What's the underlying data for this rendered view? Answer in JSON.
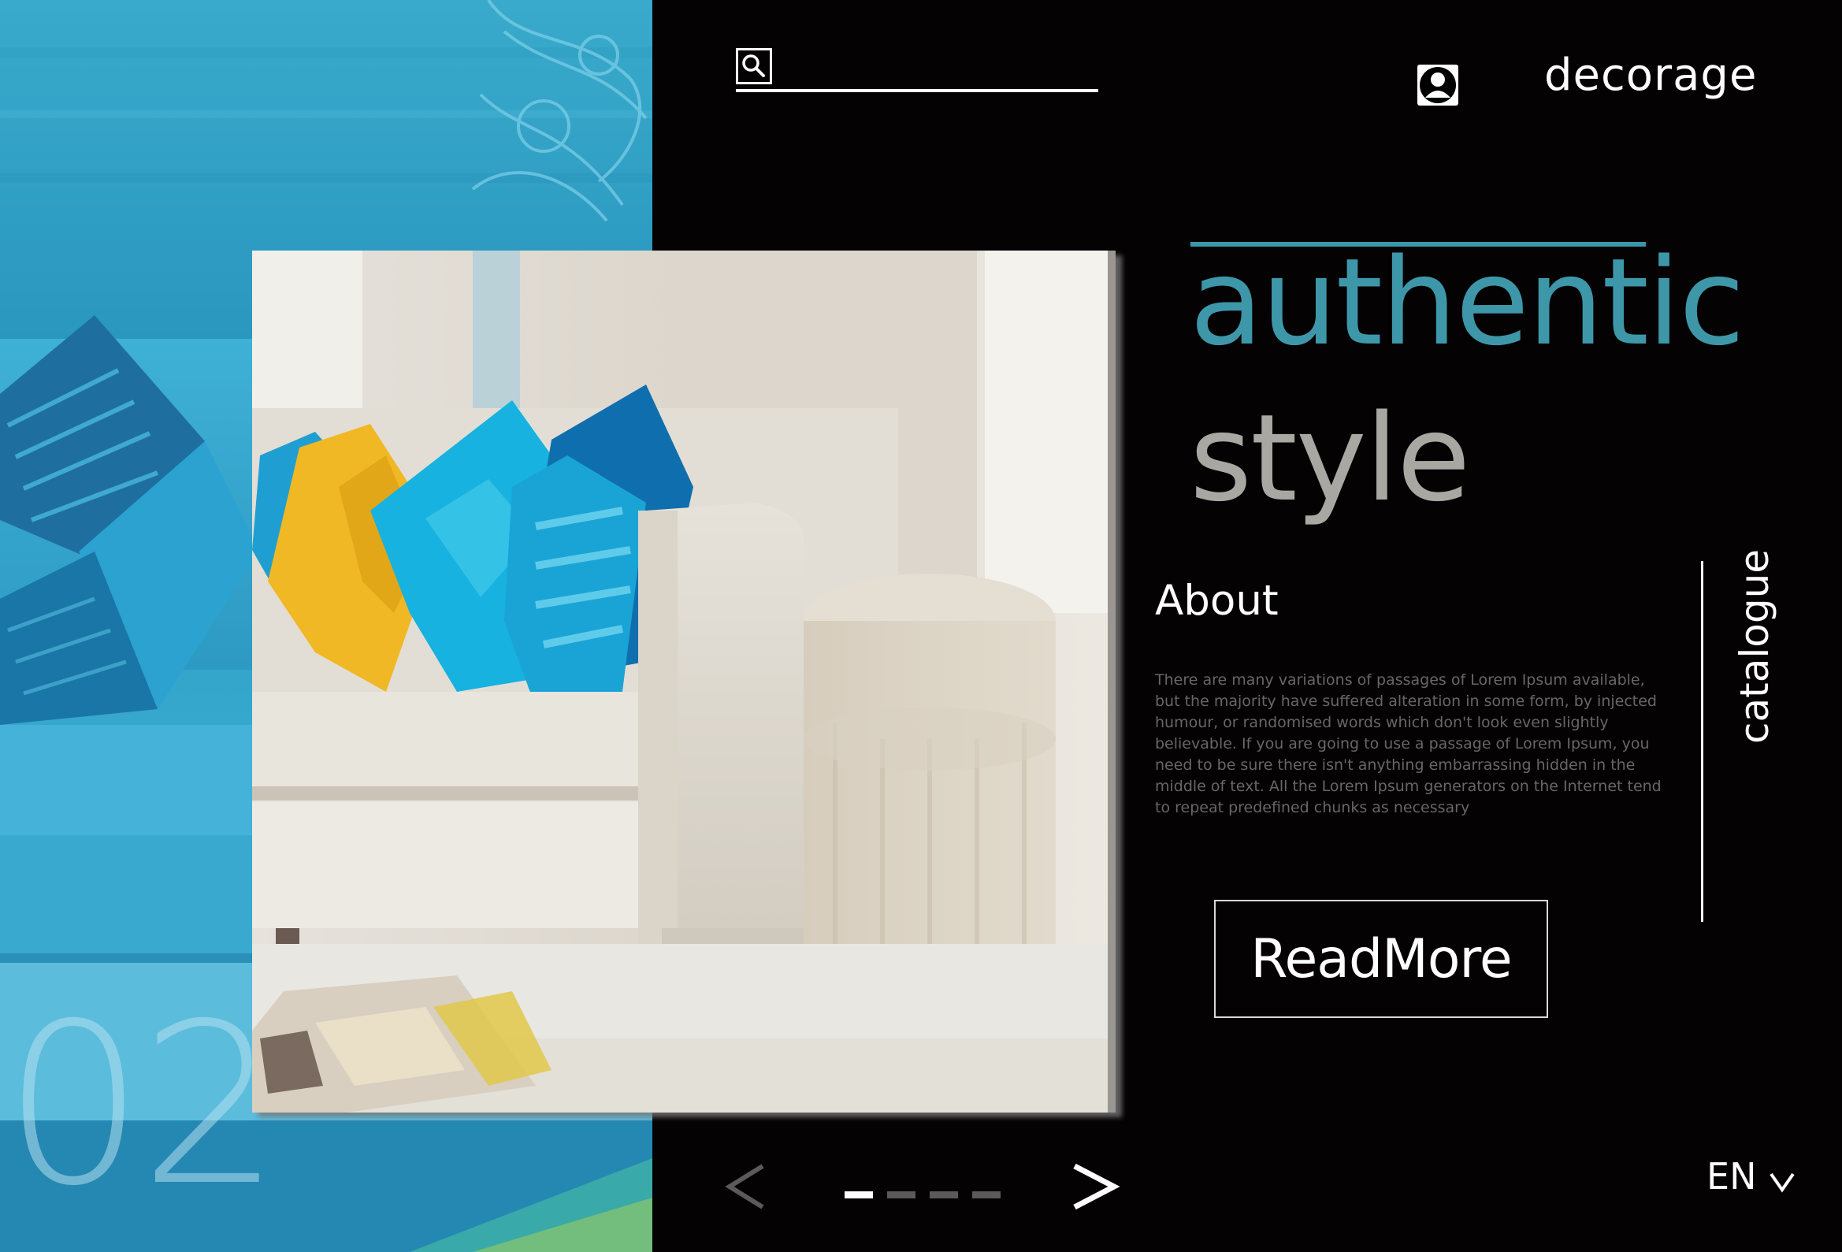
{
  "header": {
    "search_placeholder": "",
    "brand": "decorage"
  },
  "hero": {
    "headline_line1": "authentic",
    "headline_line2": "style",
    "slide_number": "02"
  },
  "about": {
    "title": "About",
    "body": "There are many variations of passages of Lorem Ipsum available, but the majority have suffered alteration in some form, by injected humour, or randomised words which don't look even slightly believable. If you are going to use a passage of Lorem Ipsum, you need to be sure there isn't anything embarrassing hidden in the middle of text. All the Lorem Ipsum generators on the Internet tend to repeat predefined chunks as necessary",
    "button_label": "ReadMore"
  },
  "side_nav": {
    "label": "catalogue"
  },
  "pagination": {
    "total": 4,
    "active": 1
  },
  "language": {
    "label": "EN"
  },
  "colors": {
    "accent": "#3d97a9",
    "headline_secondary": "#a9a7a2",
    "background": "#050203",
    "left_panel": "#2fa2c6"
  },
  "icons": {
    "search": "search-icon",
    "user": "user-icon",
    "prev": "chevron-left-icon",
    "next": "chevron-right-icon",
    "language_dropdown": "chevron-down-icon"
  }
}
